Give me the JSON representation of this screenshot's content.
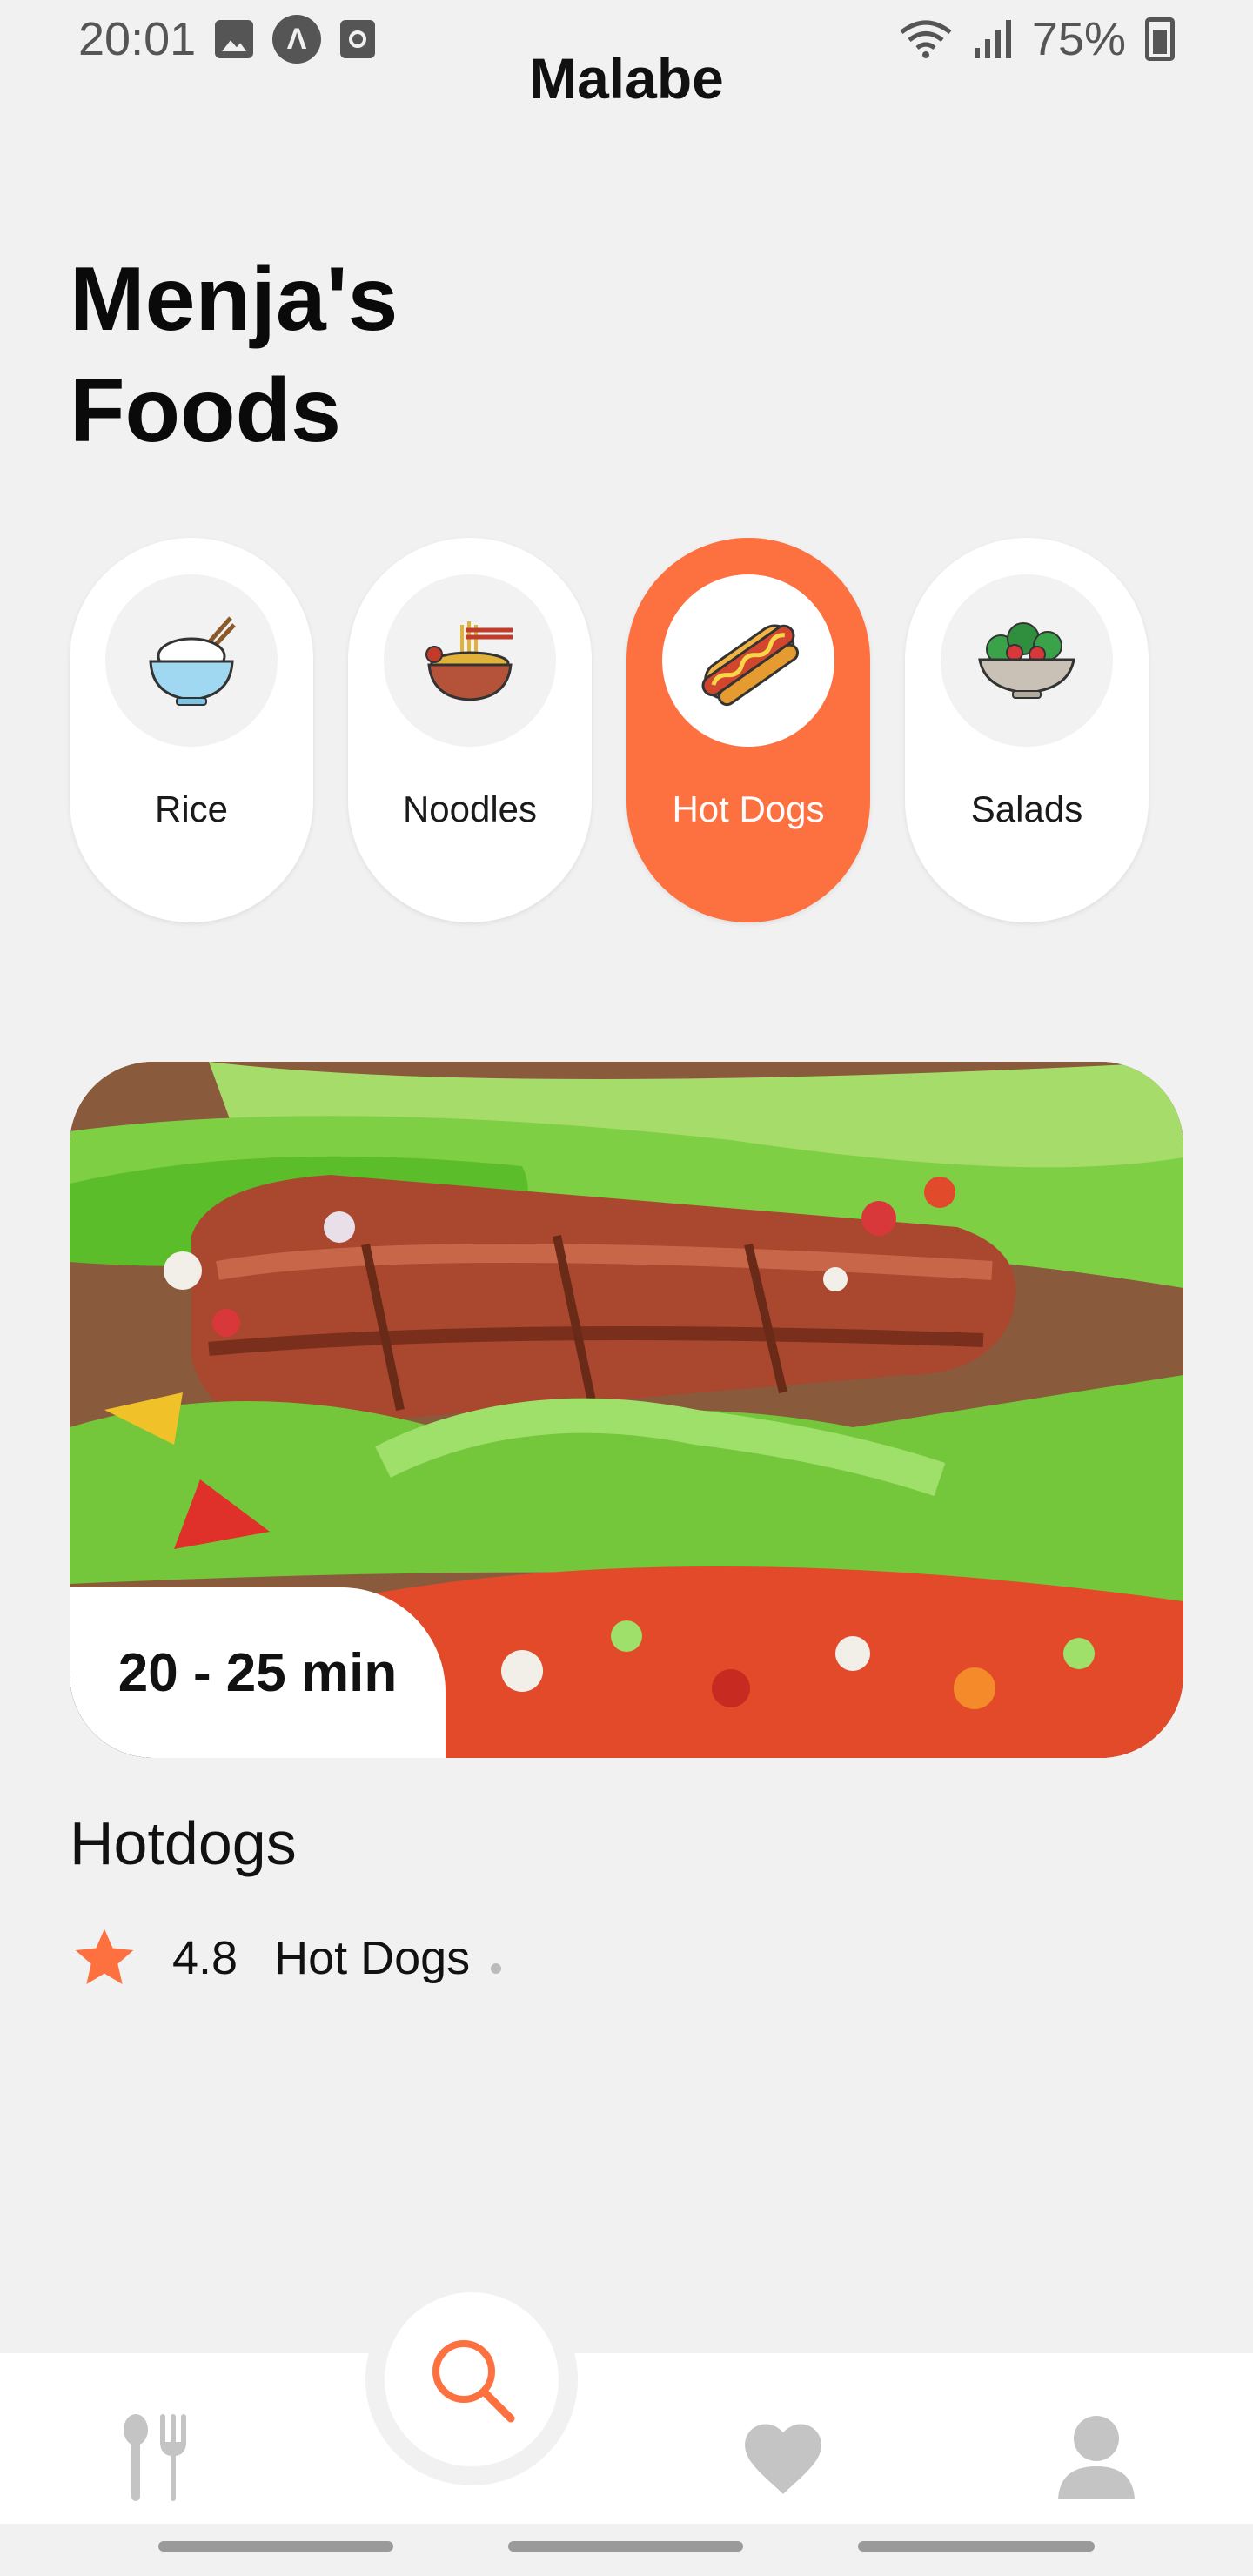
{
  "status_bar": {
    "time": "20:01",
    "battery": "75%",
    "icons": [
      "image-icon",
      "app-icon",
      "alarm-icon",
      "wifi-icon",
      "signal-icon",
      "battery-charging-icon"
    ]
  },
  "header": {
    "title": "Malabe"
  },
  "heading": {
    "line1": "Menja's",
    "line2": "Foods"
  },
  "categories": [
    {
      "label": "Rice",
      "icon": "rice-bowl-icon",
      "selected": false
    },
    {
      "label": "Noodles",
      "icon": "noodles-icon",
      "selected": false
    },
    {
      "label": "Hot Dogs",
      "icon": "hot-dog-icon",
      "selected": true
    },
    {
      "label": "Salads",
      "icon": "salad-icon",
      "selected": false
    }
  ],
  "food_card": {
    "time": "20 - 25 min",
    "title": "Hotdogs",
    "rating": "4.8",
    "category": "Hot Dogs"
  },
  "bottom_nav": {
    "items": [
      "food-icon",
      "search-icon",
      "favorites-icon",
      "profile-icon"
    ],
    "active": "search-icon"
  },
  "colors": {
    "accent": "#fd7040",
    "background": "#f1f1f2",
    "nav_inactive": "#c4c4c4"
  }
}
